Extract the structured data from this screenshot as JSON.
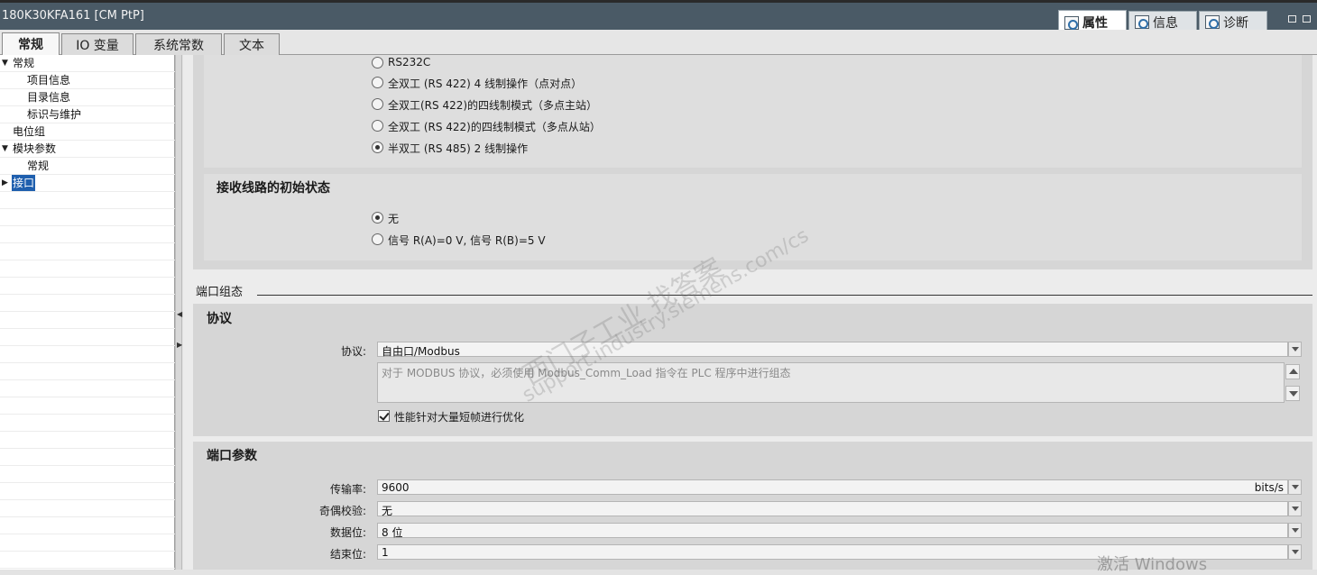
{
  "window": {
    "title": "180K30KFA161 [CM PtP]",
    "inspector_tabs": [
      {
        "label": "属性",
        "active": true
      },
      {
        "label": "信息",
        "active": false
      },
      {
        "label": "诊断",
        "active": false
      }
    ]
  },
  "tabs": [
    {
      "label": "常规",
      "active": true
    },
    {
      "label": "IO 变量",
      "active": false
    },
    {
      "label": "系统常数",
      "active": false
    },
    {
      "label": "文本",
      "active": false
    }
  ],
  "tree": {
    "items": [
      {
        "label": "常规",
        "level": 0,
        "expanded": true
      },
      {
        "label": "项目信息",
        "level": 1
      },
      {
        "label": "目录信息",
        "level": 1
      },
      {
        "label": "标识与维护",
        "level": 1
      },
      {
        "label": "电位组",
        "level": 0
      },
      {
        "label": "模块参数",
        "level": 0,
        "expanded": true
      },
      {
        "label": "常规",
        "level": 1
      },
      {
        "label": "接口",
        "level": 0,
        "expanded": false,
        "selected": true
      }
    ]
  },
  "operating_mode": {
    "options": [
      {
        "label": "RS232C",
        "selected": false
      },
      {
        "label": "全双工 (RS 422) 4 线制操作（点对点）",
        "selected": false
      },
      {
        "label": "全双工(RS 422)的四线制模式（多点主站）",
        "selected": false
      },
      {
        "label": "全双工 (RS 422)的四线制模式（多点从站）",
        "selected": false
      },
      {
        "label": "半双工 (RS 485) 2 线制操作",
        "selected": true
      }
    ]
  },
  "receive_line": {
    "title": "接收线路的初始状态",
    "options": [
      {
        "label": "无",
        "selected": true
      },
      {
        "label": "信号 R(A)=0 V, 信号 R(B)=5 V",
        "selected": false
      }
    ]
  },
  "port_config": {
    "section_label": "端口组态",
    "protocol_group": {
      "title": "协议",
      "protocol_label": "协议:",
      "protocol_value": "自由口/Modbus",
      "note": "对于 MODBUS 协议，必须使用 Modbus_Comm_Load 指令在 PLC 程序中进行组态",
      "optimize_label": "性能针对大量短帧进行优化",
      "optimize_checked": true
    },
    "port_params": {
      "title": "端口参数",
      "baud_label": "传输率:",
      "baud_value": "9600",
      "baud_unit": "bits/s",
      "parity_label": "奇偶校验:",
      "parity_value": "无",
      "databits_label": "数据位:",
      "databits_value": "8 位",
      "stopbits_label": "结束位:",
      "stopbits_value": "1"
    }
  },
  "watermark": {
    "line1": "西门子工业  找答案",
    "line2": "support.industry.siemens.com/cs"
  },
  "os_overlay": "激活 Windows",
  "colors": {
    "accent_orange": "#f0a020",
    "titlebar": "#4a5a66",
    "selection": "#1f5fae"
  }
}
